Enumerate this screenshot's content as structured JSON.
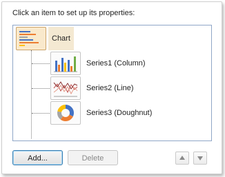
{
  "prompt": "Click an item to set up its properties:",
  "tree": {
    "root": {
      "label": "Chart",
      "icon": "chart-thumbnail-icon",
      "selected": true
    },
    "series": [
      {
        "label": "Series1 (Column)",
        "icon": "column-chart-thumbnail-icon"
      },
      {
        "label": "Series2 (Line)",
        "icon": "line-chart-thumbnail-icon"
      },
      {
        "label": "Series3 (Doughnut)",
        "icon": "doughnut-chart-thumbnail-icon"
      }
    ]
  },
  "buttons": {
    "add_label": "Add...",
    "delete_label": "Delete",
    "move_up_icon": "arrow-up-icon",
    "move_down_icon": "arrow-down-icon"
  },
  "colors": {
    "tree_border": "#8fa6c7",
    "selection": "#f4e9d2",
    "accent_blue": "#3c7fb1"
  }
}
